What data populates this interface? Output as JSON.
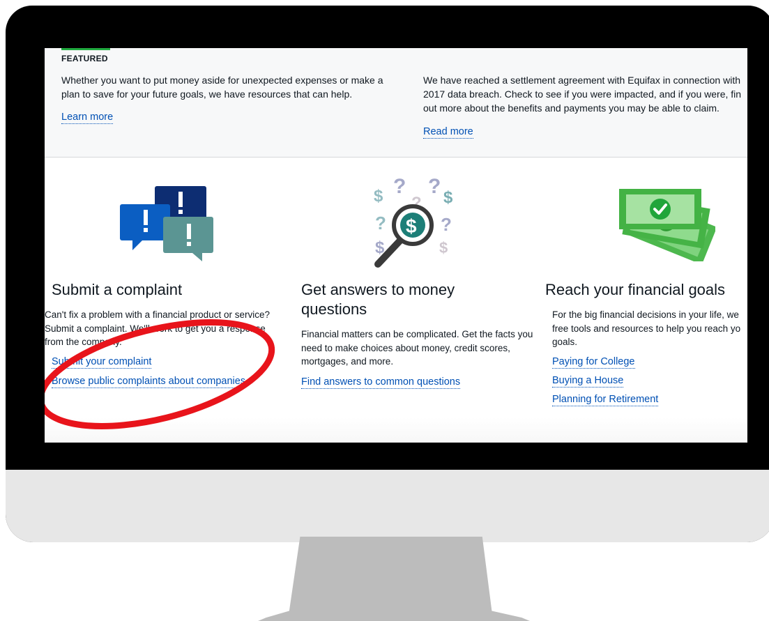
{
  "featured": {
    "label": "FEATURED",
    "left_text": "Whether you want to put money aside for unexpected expenses or make a plan to save for your future goals, we have resources that can help.",
    "left_link": "Learn more",
    "right_text": "We have reached a settlement agreement with Equifax in connection with 2017 data breach. Check to see if you were impacted, and if you were, fin out more about the benefits and payments you may be able to claim.",
    "right_link": "Read more"
  },
  "cards": [
    {
      "title": "Submit a complaint",
      "description": "Can't fix a problem with a financial product or service? Submit a complaint. We'll work to get you a response from the company.",
      "links": [
        "Submit your complaint",
        "Browse public complaints about companies"
      ],
      "icon": "speech-bubbles-icon"
    },
    {
      "title": "Get answers to money questions",
      "description": "Financial matters can be complicated. Get the facts you need to make choices about money, credit scores, mortgages, and more.",
      "links": [
        "Find answers to common questions"
      ],
      "icon": "magnifying-glass-dollar-icon"
    },
    {
      "title": "Reach your financial goals",
      "description": "For the big financial decisions in your life, we free tools and resources to help you reach yo goals.",
      "links": [
        "Paying for College",
        "Buying a House",
        "Planning for Retirement"
      ],
      "icon": "money-check-icon"
    }
  ],
  "colors": {
    "link": "#0050b4",
    "featured_accent": "#20aa3f",
    "annotation": "#e8141b"
  }
}
